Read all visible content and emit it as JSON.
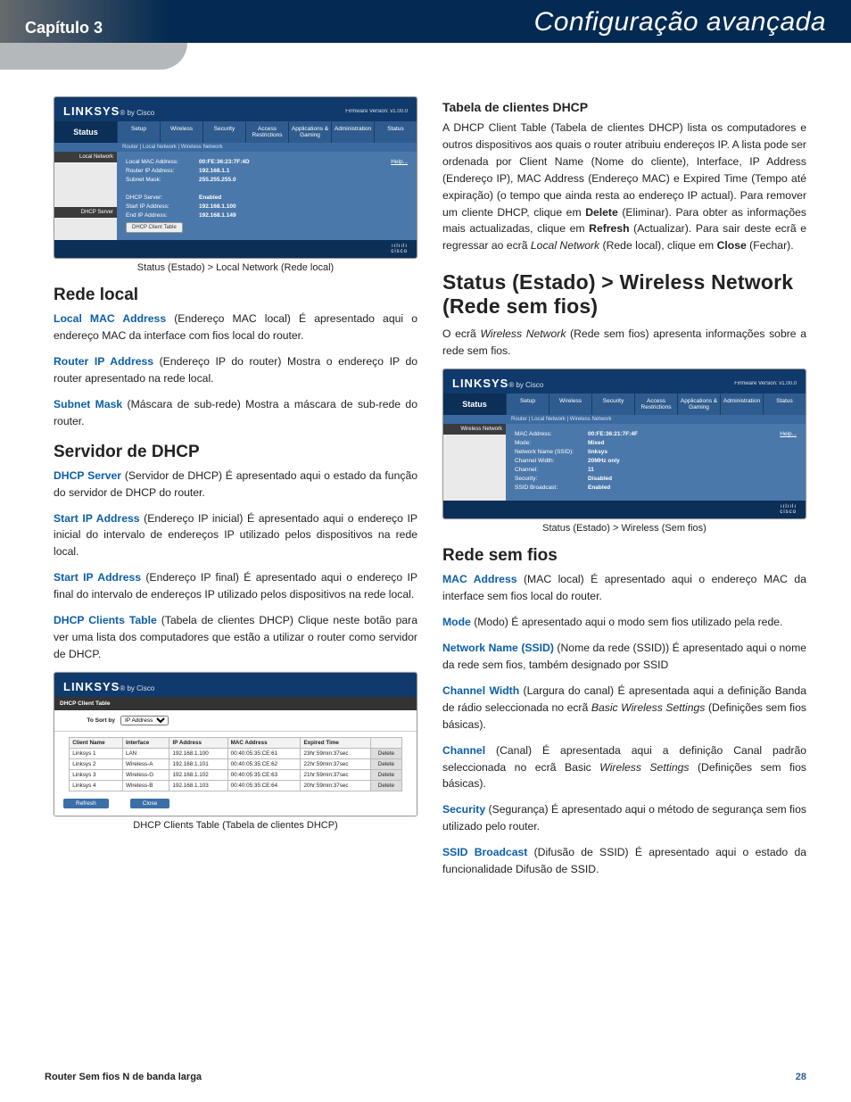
{
  "header": {
    "chapter": "Capítulo 3",
    "title": "Configuração avançada"
  },
  "captions": {
    "shot1": "Status (Estado) > Local Network (Rede local)",
    "shot2": "DHCP Clients Table (Tabela de clientes DHCP)",
    "shot3": "Status (Estado) > Wireless (Sem fios)"
  },
  "shot_common": {
    "brand": "LINKSYS",
    "brand_by": "by Cisco",
    "firmware": "Firmware Version: v1.00.0",
    "status_label": "Status",
    "tabs": [
      "Setup",
      "Wireless",
      "Security",
      "Access Restrictions",
      "Applications & Gaming",
      "Administration",
      "Status"
    ],
    "subtabs": "Router   |   Local Network   |   Wireless Network",
    "cisco": "cisco"
  },
  "shot1": {
    "side": [
      "Local Network",
      "DHCP Server"
    ],
    "help": "Help...",
    "kv1": [
      {
        "k": "Local MAC Address:",
        "v": "00:FE:36:23:7F:4D"
      },
      {
        "k": "Router IP Address:",
        "v": "192.168.1.1"
      },
      {
        "k": "Subnet Mask:",
        "v": "255.255.255.0"
      }
    ],
    "kv2": [
      {
        "k": "DHCP Server:",
        "v": "Enabled"
      },
      {
        "k": "Start IP Address:",
        "v": "192.168.1.100"
      },
      {
        "k": "End IP Address:",
        "v": "192.168.1.149"
      }
    ],
    "btn": "DHCP Client Table"
  },
  "shot2": {
    "title": "DHCP Client Table",
    "sort_label": "To Sort by",
    "sort_value": "IP Address",
    "cols": [
      "Client Name",
      "Interface",
      "IP Address",
      "MAC Address",
      "Expired Time",
      ""
    ],
    "rows": [
      [
        "Linksys 1",
        "LAN",
        "192.168.1.100",
        "00:40:05:35:CE:61",
        "23hr:59min:37sec",
        "Delete"
      ],
      [
        "Linksys 2",
        "Wireless-A",
        "192.168.1.101",
        "00:40:05:35:CE:62",
        "22hr:59min:37sec",
        "Delete"
      ],
      [
        "Linksys 3",
        "Wireless-G",
        "192.168.1.102",
        "00:40:05:35:CE:63",
        "21hr:59min:37sec",
        "Delete"
      ],
      [
        "Linksys 4",
        "Wireless-B",
        "192.168.1.103",
        "00:40:05:35:CE:64",
        "20hr:59min:37sec",
        "Delete"
      ]
    ],
    "refresh": "Refresh",
    "close": "Close"
  },
  "shot3": {
    "side": "Wireless Network",
    "help": "Help...",
    "kv": [
      {
        "k": "MAC Address:",
        "v": "00:FE:36:21:7F:4F"
      },
      {
        "k": "Mode:",
        "v": "Mixed"
      },
      {
        "k": "Network Name (SSID):",
        "v": "linksys"
      },
      {
        "k": "Channel Width:",
        "v": "20MHz only"
      },
      {
        "k": "Channel:",
        "v": "11"
      },
      {
        "k": "Security:",
        "v": "Disabled"
      },
      {
        "k": "SSID Broadcast:",
        "v": "Enabled"
      }
    ]
  },
  "left": {
    "h_rede": "Rede local",
    "p1a": "Local MAC Address",
    "p1b": " (Endereço MAC local) É apresentado aqui o endereço MAC da interface com fios local do router.",
    "p2a": "Router IP Address",
    "p2b": " (Endereço IP do router) Mostra o endereço IP do router apresentado na rede local.",
    "p3a": "Subnet Mask",
    "p3b": " (Máscara de sub-rede) Mostra a máscara de sub-rede do router.",
    "h_dhcp": "Servidor de DHCP",
    "p4a": "DHCP Server",
    "p4b": " (Servidor de DHCP) É apresentado aqui o estado da função do servidor de DHCP do router.",
    "p5a": "Start IP Address",
    "p5b": " (Endereço IP inicial) É apresentado aqui o endereço IP inicial do intervalo de endereços IP utilizado pelos dispositivos na rede local.",
    "p6a": "Start IP Address",
    "p6b": " (Endereço IP final) É apresentado aqui o endereço IP final do intervalo de endereços IP utilizado pelos dispositivos na rede local.",
    "p7a": "DHCP Clients Table",
    "p7b": " (Tabela de clientes DHCP) Clique neste botão para ver uma lista dos computadores que estão a utilizar o router como servidor de DHCP."
  },
  "right": {
    "h_tab": "Tabela de clientes DHCP",
    "p_tab1": "A DHCP Client Table (Tabela de clientes DHCP) lista os computadores e outros dispositivos aos quais o router atribuiu endereços IP. A lista pode ser ordenada por Client Name (Nome do cliente), Interface, IP Address (Endereço IP), MAC Address (Endereço MAC) e Expired Time (Tempo até expiração) (o tempo que ainda resta ao endereço IP actual). Para remover um cliente DHCP, clique em ",
    "p_tab_delete": "Delete",
    "p_tab2": " (Eliminar). Para obter as informações mais actualizadas, clique em ",
    "p_tab_refresh": "Refresh",
    "p_tab3": " (Actualizar). Para sair deste ecrã e regressar ao ecrã ",
    "p_tab_local": "Local Network",
    "p_tab4": " (Rede local), clique em ",
    "p_tab_close": "Close",
    "p_tab5": " (Fechar).",
    "h_status": "Status (Estado) > Wireless Network (Rede sem fios)",
    "p_status1": "O ecrã ",
    "p_status_i": "Wireless Network",
    "p_status2": " (Rede sem fios) apresenta informações sobre a rede sem fios.",
    "h_rsf": "Rede sem fios",
    "r1a": "MAC Address",
    "r1b": " (MAC local) É apresentado aqui o endereço MAC da interface sem fios local do router.",
    "r2a": "Mode",
    "r2b": " (Modo) É apresentado aqui o modo sem fios utilizado pela rede.",
    "r3a": "Network Name (SSID)",
    "r3b": " (Nome da rede (SSID)) É apresentado aqui o nome da rede sem fios, também designado por SSID",
    "r4a": "Channel Width",
    "r4b": " (Largura do canal) É apresentada aqui a definição Banda de rádio seleccionada no ecrã ",
    "r4i": "Basic Wireless Settings",
    "r4c": " (Definições sem fios básicas).",
    "r5a": "Channel",
    "r5b": " (Canal) É apresentada aqui a definição Canal padrão seleccionada no ecrã Basic ",
    "r5i": "Wireless Settings",
    "r5c": " (Definições sem fios básicas).",
    "r6a": "Security",
    "r6b": " (Segurança) É apresentado aqui o método de segurança sem fios utilizado pelo router.",
    "r7a": "SSID Broadcast",
    "r7b": " (Difusão de SSID) É apresentado aqui o estado da funcionalidade Difusão de SSID."
  },
  "footer": {
    "title": "Router Sem fios N de banda larga",
    "page": "28"
  }
}
